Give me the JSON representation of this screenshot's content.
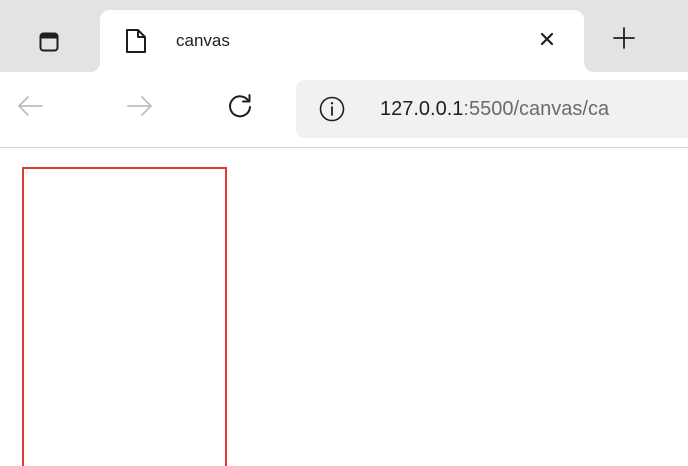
{
  "tab": {
    "title": "canvas",
    "icons": {
      "tab_actions": "tab-actions-icon",
      "favicon": "page-icon",
      "close": "close-icon",
      "new_tab": "plus-icon"
    }
  },
  "toolbar": {
    "icons": {
      "back": "arrow-left-icon",
      "forward": "arrow-right-icon",
      "refresh": "refresh-icon",
      "info": "info-icon"
    },
    "url": {
      "host": "127.0.0.1",
      "rest": ":5500/canvas/ca"
    }
  },
  "page": {
    "canvas_border_color": "#e53935"
  },
  "colors": {
    "tab_strip": "#e3e3e3",
    "address_bar": "#f1f1f1",
    "disabled_icon": "#bdbdbd",
    "text": "#1f1f1f"
  }
}
